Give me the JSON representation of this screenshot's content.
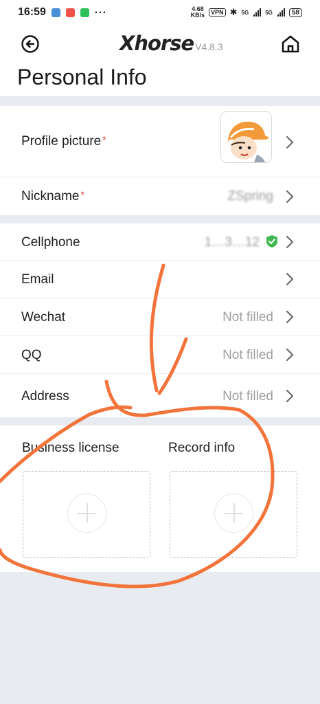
{
  "status_bar": {
    "time": "16:59",
    "speed_value": "4.68",
    "speed_unit": "KB/s",
    "vpn": "VPN",
    "net1": "5G",
    "net2": "5G",
    "battery": "58"
  },
  "header": {
    "brand": "Xhorse",
    "version": "V4.8.3",
    "title": "Personal Info"
  },
  "profile": {
    "picture_label": "Profile picture",
    "nickname_label": "Nickname",
    "nickname_value": "ZSpring",
    "required_mark": "*"
  },
  "contact": {
    "cellphone_label": "Cellphone",
    "cellphone_value": "1…3…12",
    "email_label": "Email",
    "wechat_label": "Wechat",
    "wechat_value": "Not filled",
    "qq_label": "QQ",
    "qq_value": "Not filled",
    "address_label": "Address",
    "address_value": "Not filled"
  },
  "uploads": {
    "business_license_label": "Business license",
    "record_info_label": "Record info"
  },
  "colors": {
    "background": "#e8ecf1",
    "required": "#e0352b",
    "verified": "#3fb950",
    "annotation": "#f2743a"
  },
  "icons": [
    "back-arrow-icon",
    "home-icon",
    "chevron-right-icon",
    "verified-shield-icon",
    "plus-icon"
  ]
}
